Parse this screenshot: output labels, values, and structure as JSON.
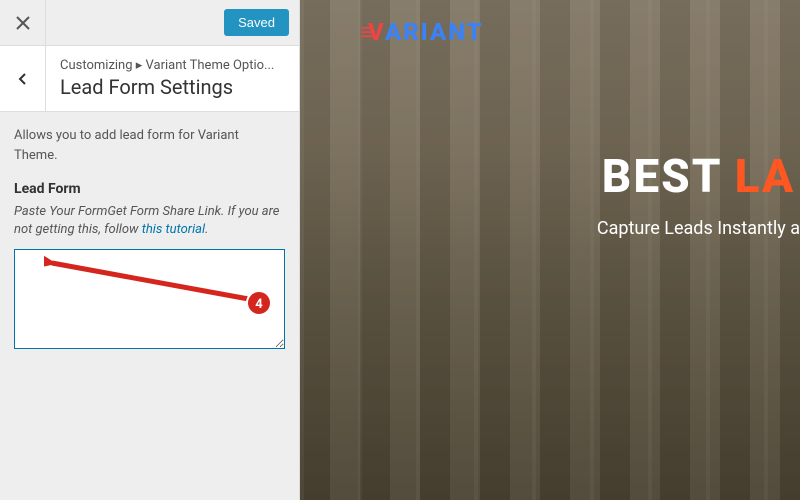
{
  "topbar": {
    "saved_label": "Saved"
  },
  "breadcrumb": {
    "root": "Customizing",
    "separator": "▸",
    "section": "Variant Theme Optio..."
  },
  "panel": {
    "title": "Lead Form Settings",
    "description": "Allows you to add lead form for Variant Theme.",
    "section_label": "Lead Form",
    "hint_prefix": "Paste Your FormGet Form Share Link. If you are not getting this, follow ",
    "hint_link_text": "this tutorial",
    "hint_suffix": ".",
    "textarea_value": ""
  },
  "annotation": {
    "step": "4"
  },
  "preview": {
    "logo_text": "VARIANT",
    "hero_white": "BEST ",
    "hero_orange": "LA",
    "hero_sub": "Capture Leads Instantly a"
  }
}
